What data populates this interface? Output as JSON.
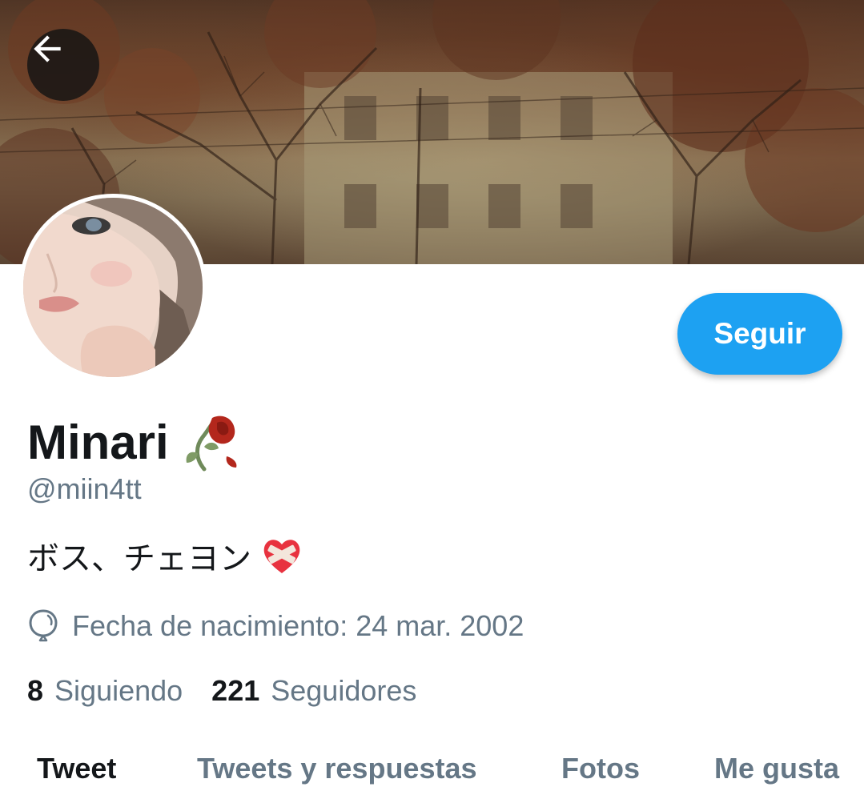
{
  "header": {
    "back_icon": "arrow-left-icon"
  },
  "profile": {
    "display_name": "Minari",
    "name_emoji": "🥀",
    "handle": "@miin4tt",
    "bio_text": "ボス、チェヨン",
    "bio_emoji": "❤️‍🩹",
    "birthdate": "Fecha de nacimiento: 24 mar. 2002",
    "birthdate_icon": "balloon-icon"
  },
  "actions": {
    "follow_label": "Seguir"
  },
  "stats": {
    "following_count": "8",
    "following_label": "Siguiendo",
    "followers_count": "221",
    "followers_label": "Seguidores"
  },
  "tabs": [
    {
      "label": "Tweet",
      "active": true
    },
    {
      "label": "Tweets y respuestas",
      "active": false
    },
    {
      "label": "Fotos",
      "active": false
    },
    {
      "label": "Me gusta",
      "active": false
    }
  ],
  "colors": {
    "accent": "#1da1f2",
    "text_primary": "#14171a",
    "text_secondary": "#657786"
  }
}
